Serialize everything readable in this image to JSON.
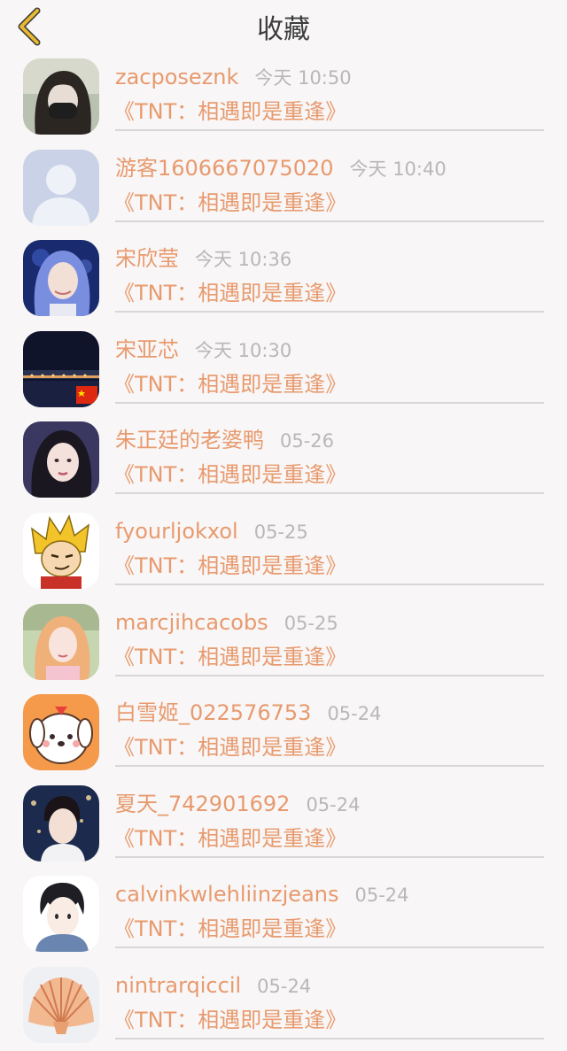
{
  "header": {
    "title": "收藏",
    "back_icon": "chevron-left-icon",
    "accent": "#e8b830"
  },
  "colors": {
    "name": "#e89a6e",
    "time": "#b8b8b8",
    "work": "#e89a6e"
  },
  "items": [
    {
      "name": "zacposeznk",
      "time": "今天 10:50",
      "work": "《TNT：相遇即是重逢》",
      "avatar": "avatar-girl-mask"
    },
    {
      "name": "游客1606667075020",
      "time": "今天 10:40",
      "work": "《TNT：相遇即是重逢》",
      "avatar": "avatar-default-person"
    },
    {
      "name": "宋欣莹",
      "time": "今天 10:36",
      "work": "《TNT：相遇即是重逢》",
      "avatar": "avatar-blue-hair-girl"
    },
    {
      "name": "宋亚芯",
      "time": "今天 10:30",
      "work": "《TNT：相遇即是重逢》",
      "avatar": "avatar-night-bridge"
    },
    {
      "name": "朱正廷的老婆鸭",
      "time": "05-26",
      "work": "《TNT：相遇即是重逢》",
      "avatar": "avatar-dark-hair-girl"
    },
    {
      "name": "fyourljokxol",
      "time": "05-25",
      "work": "《TNT：相遇即是重逢》",
      "avatar": "avatar-cartoon-blond"
    },
    {
      "name": "marcjihcacobs",
      "time": "05-25",
      "work": "《TNT：相遇即是重逢》",
      "avatar": "avatar-pink-girl"
    },
    {
      "name": "白雪姬_022576753",
      "time": "05-24",
      "work": "《TNT：相遇即是重逢》",
      "avatar": "avatar-cartoon-dog"
    },
    {
      "name": "夏天_742901692",
      "time": "05-24",
      "work": "《TNT：相遇即是重逢》",
      "avatar": "avatar-boy-lights"
    },
    {
      "name": "calvinkwlehliinzjeans",
      "time": "05-24",
      "work": "《TNT：相遇即是重逢》",
      "avatar": "avatar-anime-boy"
    },
    {
      "name": "nintrarqiccil",
      "time": "05-24",
      "work": "《TNT：相遇即是重逢》",
      "avatar": "avatar-seashell"
    }
  ]
}
